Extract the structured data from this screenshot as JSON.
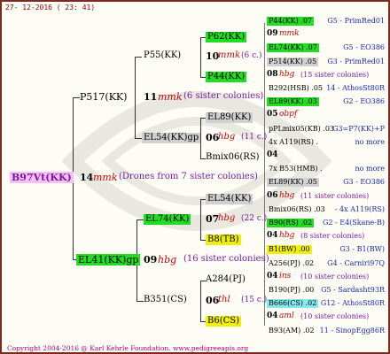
{
  "header": {
    "date": "27- 12-2016 ( 23: 41)"
  },
  "root": {
    "name": "B97Vt(KK)",
    "count": "14",
    "breed": "mmk",
    "note": "(Drones from 7 sister colonies)"
  },
  "sire": {
    "name": "P517(KK)"
  },
  "dam": {
    "name": "EL41(KK)gp"
  },
  "g2": [
    {
      "name": "P55(KK)",
      "count": "11",
      "breed": "mmk",
      "note": "(6 sister colonies)"
    },
    {
      "name": "EL54(KK)gp"
    },
    {
      "name": "EL74(KK)",
      "count": "09",
      "breed": "hbg",
      "note": "(16 sister colonies)"
    },
    {
      "name": "B351(CS)"
    }
  ],
  "g3": [
    {
      "name": "P62(KK)",
      "count": "10",
      "breed": "mmk",
      "note": "(6 c.)"
    },
    {
      "name": "P44(KK)"
    },
    {
      "name": "EL89(KK)",
      "count": "06",
      "breed": "hbg",
      "note": "(11 c.)"
    },
    {
      "name": "Bmix06(RS)"
    },
    {
      "name": "EL54(KK)",
      "count": "07",
      "breed": "hbg",
      "note": "(22 c.)"
    },
    {
      "name": "B8(TB)"
    },
    {
      "name": "A284(PJ)",
      "count": "06",
      "breed": "thl",
      "note": "(15 c.)"
    },
    {
      "name": "B6(CS)"
    }
  ],
  "g4": [
    {
      "name": "P44(KK) .07",
      "hl": "g",
      "right": "G5 - PrimRed01",
      "rc": "blue"
    },
    {
      "name": "09",
      "breed": "mmk",
      "note": ""
    },
    {
      "name": "EL74(KK) .07",
      "hl": "g",
      "right": "G5 - EO386",
      "rc": "blue"
    },
    {
      "name": "P514(KK) .05",
      "hl": "gr",
      "right": "G3 - PrimRed01",
      "rc": "blue"
    },
    {
      "name": "08",
      "breed": "hbg",
      "note": "(15 sister colonies)"
    },
    {
      "name": "B292(HSB) .05",
      "right": "14 - AthosSt80R",
      "rc": "blue"
    },
    {
      "name": "EL89(KK) .03",
      "hl": "g",
      "right": "G2 - EO386",
      "rc": "blue"
    },
    {
      "name": "05",
      "breed": "obpf",
      "note": ""
    },
    {
      "name": "pPLmix05(KB) .03",
      "right": "G3=P7(KK)+P",
      "rc": "blue"
    },
    {
      "name": "4x A119(RS) .",
      "right": "no more",
      "rc": "blue"
    },
    {
      "name": "04",
      "breed": "",
      "note": ""
    },
    {
      "name": "7x B53(HMB) .",
      "right": "no more",
      "rc": "blue"
    },
    {
      "name": "EL89(KK) .05",
      "hl": "gr",
      "right": "G3 - EO386",
      "rc": "blue"
    },
    {
      "name": "06",
      "breed": "hbg",
      "note": "(11 sister colonies)"
    },
    {
      "name": "Bmix06(RS) .03",
      "right": "- 4x A119(RS)",
      "rc": "blue"
    },
    {
      "name": "B90(RS) .02",
      "hl": "g",
      "right": "G2 - E4(Skane-B)",
      "rc": "blue"
    },
    {
      "name": "04",
      "breed": "hbg",
      "note": "(8 sister colonies)"
    },
    {
      "name": "B1(BW) .00",
      "hl": "y",
      "right": "G3 - B1(BW)",
      "rc": "blue"
    },
    {
      "name": "A256(PJ) .02",
      "right": "G4 - Carniri97Q",
      "rc": "blue"
    },
    {
      "name": "04",
      "breed": "ins",
      "note": "(10 sister colonies)"
    },
    {
      "name": "B190(PJ) .00",
      "right": "G5 - Sardasht93R",
      "rc": "blue"
    },
    {
      "name": "B666(CS) .02",
      "hl": "c",
      "right": "G12 - AthosSt80R",
      "rc": "blue"
    },
    {
      "name": "04",
      "breed": "aml",
      "note": "(10 sister colonies)"
    },
    {
      "name": "B93(AM) .02",
      "right": "11 - SinopEgg86R",
      "rc": "blue"
    }
  ],
  "footer": {
    "copyright": "Copyright 2004-2016 @ Karl Kehrle Foundation.   www.pedigreeapis.org"
  }
}
